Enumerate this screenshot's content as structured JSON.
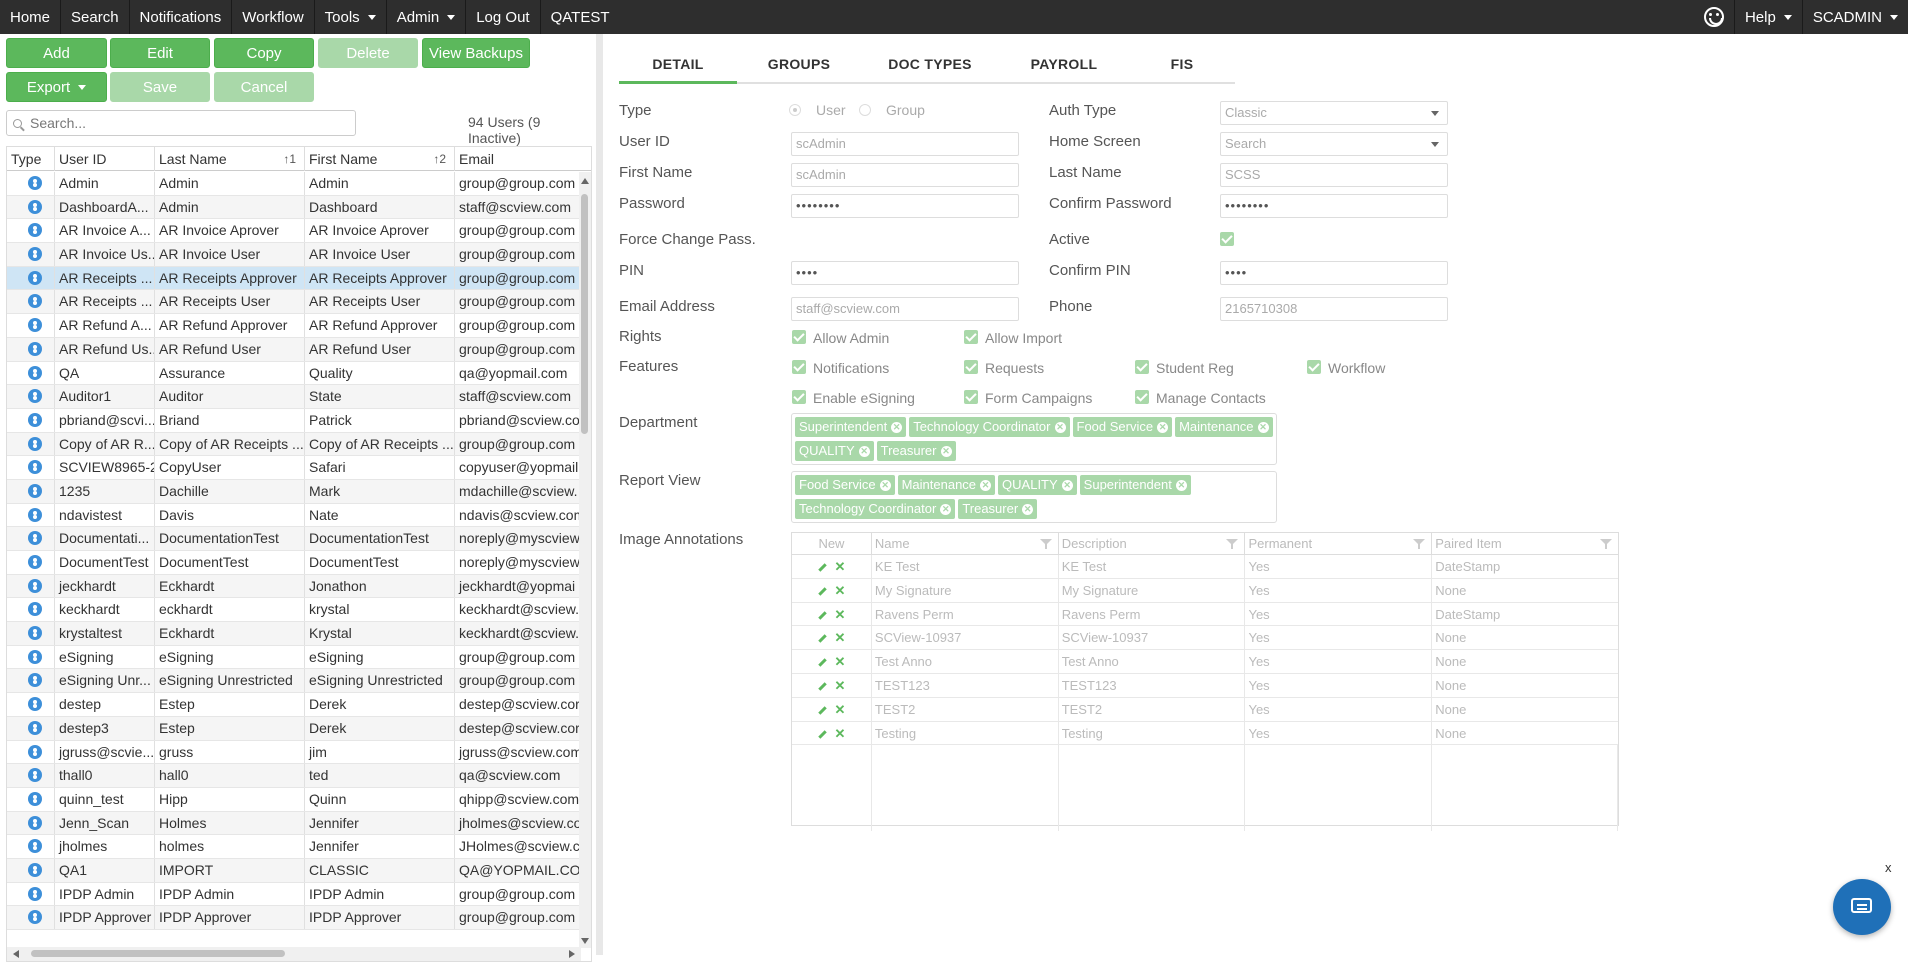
{
  "nav": {
    "items": [
      "Home",
      "Search",
      "Notifications",
      "Workflow",
      "Tools",
      "Admin",
      "Log Out",
      "QATEST"
    ],
    "help": "Help",
    "user": "SCADMIN"
  },
  "toolbar": {
    "add": "Add",
    "edit": "Edit",
    "copy": "Copy",
    "delete": "Delete",
    "view_backups": "View Backups",
    "export": "Export",
    "save": "Save",
    "cancel": "Cancel"
  },
  "search": {
    "placeholder": "Search..."
  },
  "user_count": "94 Users (9 Inactive)",
  "grid": {
    "columns": [
      "Type",
      "User ID",
      "Last Name",
      "First Name",
      "Email"
    ],
    "sort_last_name": "↑1",
    "sort_first_name": "↑2",
    "rows": [
      {
        "id": "Admin",
        "last": "Admin",
        "first": "Admin",
        "email": "group@group.com"
      },
      {
        "id": "DashboardA...",
        "last": "Admin",
        "first": "Dashboard",
        "email": "staff@scview.com"
      },
      {
        "id": "AR Invoice A...",
        "last": "AR Invoice Aprover",
        "first": "AR Invoice Aprover",
        "email": "group@group.com"
      },
      {
        "id": "AR Invoice Us...",
        "last": "AR Invoice User",
        "first": "AR Invoice User",
        "email": "group@group.com"
      },
      {
        "id": "AR Receipts ...",
        "last": "AR Receipts Approver",
        "first": "AR Receipts Approver",
        "email": "group@group.com"
      },
      {
        "id": "AR Receipts ...",
        "last": "AR Receipts User",
        "first": "AR Receipts User",
        "email": "group@group.com"
      },
      {
        "id": "AR Refund A...",
        "last": "AR Refund Approver",
        "first": "AR Refund Approver",
        "email": "group@group.com"
      },
      {
        "id": "AR Refund Us...",
        "last": "AR Refund User",
        "first": "AR Refund User",
        "email": "group@group.com"
      },
      {
        "id": "QA",
        "last": "Assurance",
        "first": "Quality",
        "email": "qa@yopmail.com"
      },
      {
        "id": "Auditor1",
        "last": "Auditor",
        "first": "State",
        "email": "staff@scview.com"
      },
      {
        "id": "pbriand@scvi...",
        "last": "Briand",
        "first": "Patrick",
        "email": "pbriand@scview.co"
      },
      {
        "id": "Copy of AR R...",
        "last": "Copy of AR Receipts ...",
        "first": "Copy of AR Receipts ...",
        "email": "group@group.com"
      },
      {
        "id": "SCVIEW8965-2",
        "last": "CopyUser",
        "first": "Safari",
        "email": "copyuser@yopmail"
      },
      {
        "id": "1235",
        "last": "Dachille",
        "first": "Mark",
        "email": "mdachille@scview."
      },
      {
        "id": "ndavistest",
        "last": "Davis",
        "first": "Nate",
        "email": "ndavis@scview.com"
      },
      {
        "id": "Documentati...",
        "last": "DocumentationTest",
        "first": "DocumentationTest",
        "email": "noreply@myscview"
      },
      {
        "id": "DocumentTest",
        "last": "DocumentTest",
        "first": "DocumentTest",
        "email": "noreply@myscview"
      },
      {
        "id": "jeckhardt",
        "last": "Eckhardt",
        "first": "Jonathon",
        "email": "jeckhardt@yopmai"
      },
      {
        "id": "keckhardt",
        "last": "eckhardt",
        "first": "krystal",
        "email": "keckhardt@scview."
      },
      {
        "id": "krystaltest",
        "last": "Eckhardt",
        "first": "Krystal",
        "email": "keckhardt@scview."
      },
      {
        "id": "eSigning",
        "last": "eSigning",
        "first": "eSigning",
        "email": "group@group.com"
      },
      {
        "id": "eSigning Unr...",
        "last": "eSigning Unrestricted",
        "first": "eSigning Unrestricted",
        "email": "group@group.com"
      },
      {
        "id": "destep",
        "last": "Estep",
        "first": "Derek",
        "email": "destep@scview.cor"
      },
      {
        "id": "destep3",
        "last": "Estep",
        "first": "Derek",
        "email": "destep@scview.cor"
      },
      {
        "id": "jgruss@scvie...",
        "last": "gruss",
        "first": "jim",
        "email": "jgruss@scview.com"
      },
      {
        "id": "thall0",
        "last": "hall0",
        "first": "ted",
        "email": "qa@scview.com"
      },
      {
        "id": "quinn_test",
        "last": "Hipp",
        "first": "Quinn",
        "email": "qhipp@scview.com"
      },
      {
        "id": "Jenn_Scan",
        "last": "Holmes",
        "first": "Jennifer",
        "email": "jholmes@scview.co"
      },
      {
        "id": "jholmes",
        "last": "holmes",
        "first": "Jennifer",
        "email": "JHolmes@scview.co"
      },
      {
        "id": "QA1",
        "last": "IMPORT",
        "first": "CLASSIC",
        "email": "QA@YOPMAIL.COM"
      },
      {
        "id": "IPDP Admin",
        "last": "IPDP Admin",
        "first": "IPDP Admin",
        "email": "group@group.com"
      },
      {
        "id": "IPDP Approver",
        "last": "IPDP Approver",
        "first": "IPDP Approver",
        "email": "group@group.com"
      }
    ],
    "selected_index": 4
  },
  "tabs": [
    "DETAIL",
    "GROUPS",
    "DOC TYPES",
    "PAYROLL",
    "FIS"
  ],
  "detail": {
    "labels": {
      "type": "Type",
      "auth_type": "Auth Type",
      "user_id": "User ID",
      "home_screen": "Home Screen",
      "first_name": "First Name",
      "last_name": "Last Name",
      "password": "Password",
      "confirm_password": "Confirm Password",
      "force_change": "Force Change Pass.",
      "active": "Active",
      "pin": "PIN",
      "confirm_pin": "Confirm PIN",
      "email": "Email Address",
      "phone": "Phone",
      "rights": "Rights",
      "features": "Features",
      "department": "Department",
      "report_view": "Report View",
      "image_annotations": "Image Annotations"
    },
    "type_options": [
      "User",
      "Group"
    ],
    "auth_type": "Classic",
    "home_screen": "Search",
    "user_id": "scAdmin",
    "first_name": "scAdmin",
    "last_name": "SCSS",
    "password": "••••••••",
    "confirm_password": "••••••••",
    "pin": "••••",
    "confirm_pin": "••••",
    "email": "staff@scview.com",
    "phone": "2165710308",
    "rights": [
      "Allow Admin",
      "Allow Import"
    ],
    "features": [
      "Notifications",
      "Requests",
      "Student Reg",
      "Workflow",
      "Enable eSigning",
      "Form Campaigns",
      "Manage Contacts"
    ],
    "department": [
      "Superintendent",
      "Technology Coordinator",
      "Food Service",
      "Maintenance",
      "QUALITY",
      "Treasurer"
    ],
    "report_view": [
      "Food Service",
      "Maintenance",
      "QUALITY",
      "Superintendent",
      "Technology Coordinator",
      "Treasurer"
    ]
  },
  "annotations": {
    "columns": [
      "New",
      "Name",
      "Description",
      "Permanent",
      "Paired Item"
    ],
    "rows": [
      {
        "name": "KE Test",
        "desc": "KE Test",
        "perm": "Yes",
        "paired": "DateStamp"
      },
      {
        "name": "My Signature",
        "desc": "My Signature",
        "perm": "Yes",
        "paired": "None"
      },
      {
        "name": "Ravens Perm",
        "desc": "Ravens Perm",
        "perm": "Yes",
        "paired": "DateStamp"
      },
      {
        "name": "SCView-10937",
        "desc": "SCView-10937",
        "perm": "Yes",
        "paired": "None"
      },
      {
        "name": "Test Anno",
        "desc": "Test Anno",
        "perm": "Yes",
        "paired": "None"
      },
      {
        "name": "TEST123",
        "desc": "TEST123",
        "perm": "Yes",
        "paired": "None"
      },
      {
        "name": "TEST2",
        "desc": "TEST2",
        "perm": "Yes",
        "paired": "None"
      },
      {
        "name": "Testing",
        "desc": "Testing",
        "perm": "Yes",
        "paired": "None"
      }
    ]
  },
  "chat": {
    "close": "x"
  },
  "colors": {
    "nav_bg": "#2e2e2e",
    "accent": "#5cb85c",
    "accent_disabled": "#a9d8a9",
    "selected_row": "#cfe5f5",
    "user_icon": "#3d8fd9"
  }
}
